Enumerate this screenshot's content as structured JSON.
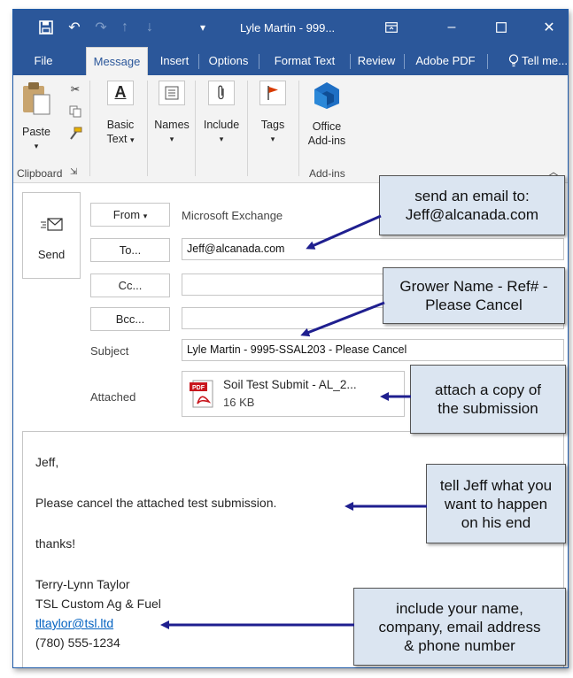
{
  "window": {
    "title": "Lyle Martin - 999..."
  },
  "tabs": [
    "File",
    "Message",
    "Insert",
    "Options",
    "Format Text",
    "Review",
    "Adobe PDF",
    "Tell me..."
  ],
  "ribbon": {
    "paste_label": "Paste",
    "basic_text_label_1": "Basic",
    "basic_text_label_2": "Text",
    "names_label": "Names",
    "include_label": "Include",
    "tags_label": "Tags",
    "office_addins_label_1": "Office",
    "office_addins_label_2": "Add-ins",
    "group_clipboard": "Clipboard",
    "group_addins": "Add-ins"
  },
  "header": {
    "send_label": "Send",
    "from_label": "From",
    "from_value": "Microsoft Exchange",
    "to_label": "To...",
    "to_value": "Jeff@alcanada.com",
    "cc_label": "Cc...",
    "bcc_label": "Bcc...",
    "subject_label": "Subject",
    "subject_value": "Lyle Martin - 9995-SSAL203 - Please Cancel",
    "attached_label": "Attached",
    "attachment_name": "Soil Test Submit - AL_2...",
    "attachment_size": "16 KB",
    "attachment_badge": "PDF"
  },
  "body": {
    "greeting": "Jeff,",
    "line1": "Please cancel the attached test submission.",
    "line2": "thanks!",
    "sig_name": "Terry-Lynn Taylor",
    "sig_company": "TSL Custom Ag & Fuel",
    "sig_email": "tltaylor@tsl.ltd",
    "sig_phone": "(780) 555-1234"
  },
  "callouts": {
    "c1_line1": "send an email to:",
    "c1_line2": "Jeff@alcanada.com",
    "c2_line1": "Grower Name - Ref# -",
    "c2_line2": "Please Cancel",
    "c3_line1": "attach a copy of",
    "c3_line2": "the submission",
    "c4_line1": "tell Jeff what you",
    "c4_line2": "want to happen",
    "c4_line3": "on his end",
    "c5_line1": "include your name,",
    "c5_line2": "company, email address",
    "c5_line3": "& phone number"
  },
  "colors": {
    "title_bar": "#2b579a",
    "callout_fill": "#dbe5f1",
    "arrow": "#1f1f8f",
    "link": "#0563c1"
  }
}
